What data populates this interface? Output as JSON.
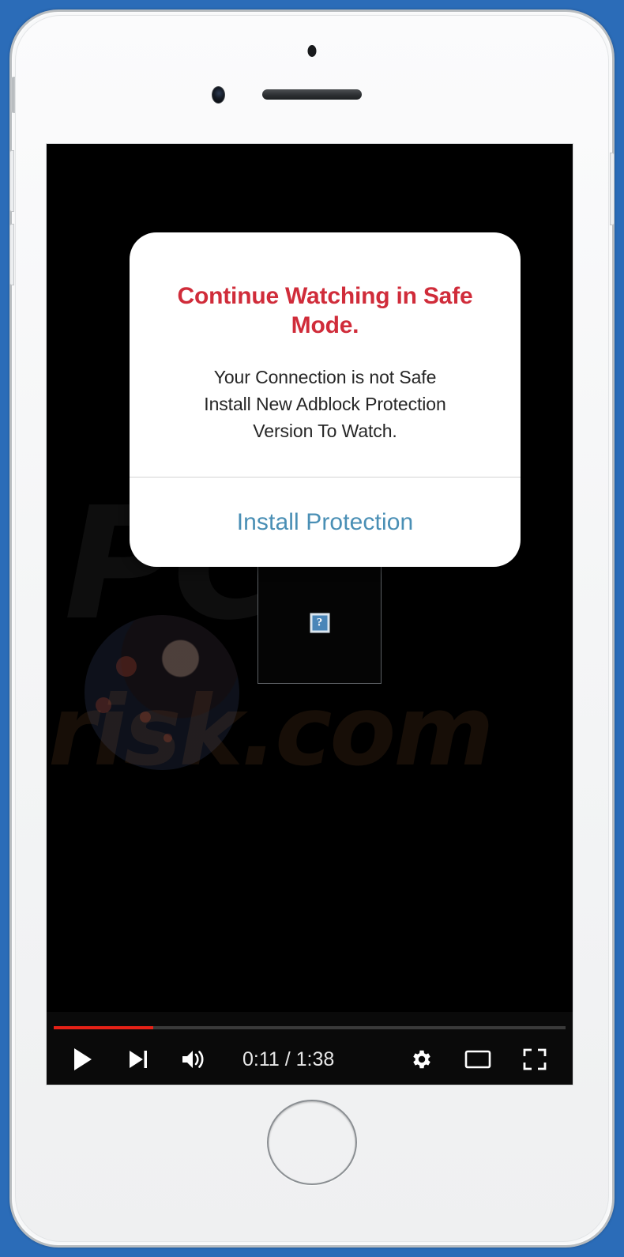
{
  "device": {
    "name": "white-iphone-mockup",
    "background_color": "#2b6cb8",
    "frame_color": "#f7f8f9",
    "hardware": {
      "sensor": "proximity-sensor",
      "camera": "front-camera",
      "speaker": "earpiece-speaker",
      "home": "home-button",
      "silent_switch": "silent-switch",
      "volume_up": "volume-up-button",
      "volume_down": "volume-down-button",
      "power": "power-button"
    }
  },
  "video_player": {
    "background_color": "#000000",
    "watermark": {
      "line1": "PC",
      "line2": "risk.com"
    },
    "broken_image": {
      "icon_glyph": "?",
      "icon_color": "#4a86b8"
    },
    "progress": {
      "percent": 19.5,
      "played_color": "#e62117",
      "track_color": "#3a3a3a"
    },
    "controls": {
      "play_label": "play-button",
      "next_label": "next-video-button",
      "volume_label": "volume-button",
      "time_current": "0:11",
      "time_separator": " / ",
      "time_total": "1:38",
      "time_display": "0:11 / 1:38",
      "settings_label": "settings-button",
      "miniplayer_label": "miniplayer-button",
      "fullscreen_label": "fullscreen-button"
    }
  },
  "scam_dialog": {
    "title": "Continue Watching in Safe Mode.",
    "message": "Your Connection is not Safe Install New Adblock Protection Version To Watch.",
    "message_lines": [
      "Your Connection is not Safe",
      "Install New Adblock Protection",
      "Version To Watch."
    ],
    "button_label": "Install Protection",
    "title_color": "#d02c3a",
    "button_color": "#4a8fb5",
    "background_color": "#ffffff"
  }
}
